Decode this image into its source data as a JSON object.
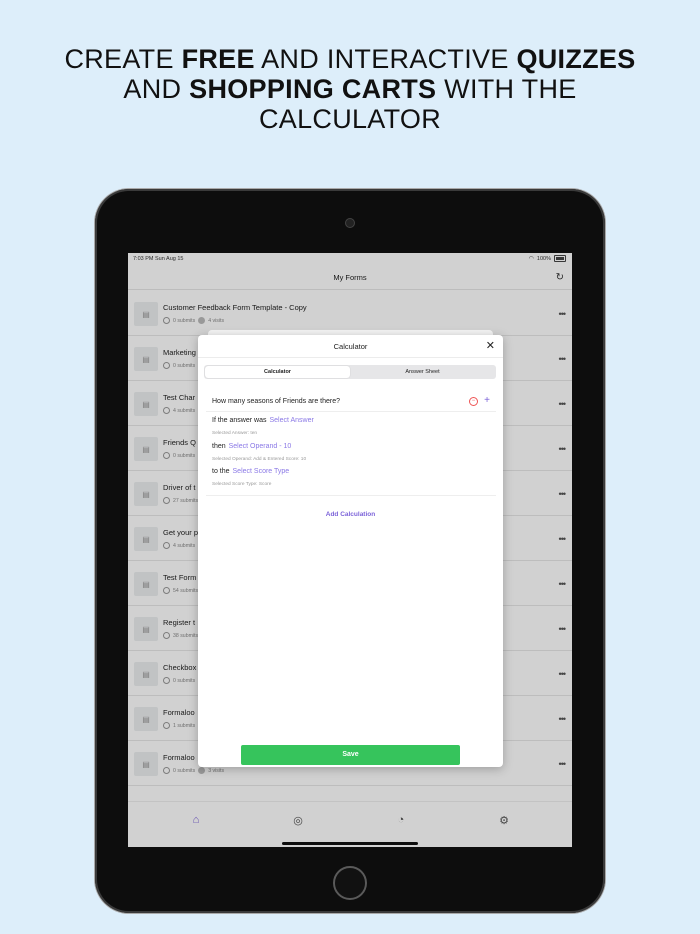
{
  "headline": {
    "line1_a": "CREATE ",
    "line1_b": "FREE",
    "line1_c": " AND INTERACTIVE ",
    "line1_d": "QUIZZES",
    "line2_a": "AND ",
    "line2_b": "SHOPPING CARTS",
    "line2_c": " WITH THE",
    "line3": "CALCULATOR"
  },
  "status": {
    "time": "7:03 PM   Sun Aug 15",
    "battery": "100%"
  },
  "nav": {
    "title": "My Forms",
    "refresh_icon": "refresh-icon"
  },
  "forms": [
    {
      "title": "Customer Feedback Form Template - Copy",
      "submits": "0 submits",
      "visits": "4 visits"
    },
    {
      "title": "Marketing",
      "submits": "0 submits",
      "visits": ""
    },
    {
      "title": "Test Char",
      "submits": "4 submits",
      "visits": ""
    },
    {
      "title": "Friends Q",
      "submits": "0 submits",
      "visits": ""
    },
    {
      "title": "Driver of t",
      "submits": "27 submits",
      "visits": ""
    },
    {
      "title": "Get your p",
      "submits": "4 submits",
      "visits": ""
    },
    {
      "title": "Test Form",
      "submits": "54 submits",
      "visits": ""
    },
    {
      "title": "Register t",
      "submits": "38 submits",
      "visits": ""
    },
    {
      "title": "Checkbox",
      "submits": "0 submits",
      "visits": ""
    },
    {
      "title": "Formaloo",
      "submits": "1 submits",
      "visits": ""
    },
    {
      "title": "Formaloo",
      "submits": "0 submits",
      "visits": "3 visits"
    }
  ],
  "more_glyph": "•••",
  "modal": {
    "title": "Calculator",
    "tabs": [
      "Calculator",
      "Answer Sheet"
    ],
    "question": "How many seasons of Friends are there?",
    "if_label": "If the answer was",
    "select_answer": "Select Answer",
    "selected_answer_hint": "Selected Answer: ten",
    "then_label": "then",
    "select_operand": "Select Operand  -  10",
    "selected_operand_hint": "Selected Operand: Add  &  Entered Score: 10",
    "to_label": "to the",
    "select_score_type": "Select Score Type",
    "selected_score_hint": "Selected Score Type: Score",
    "add_calculation": "Add Calculation",
    "save": "Save"
  },
  "tabbar": [
    "home-icon",
    "forms-icon",
    "charts-icon",
    "settings-icon"
  ],
  "colors": {
    "accent": "#7c63d9",
    "save": "#36c45c",
    "background": "#ddeefa"
  }
}
